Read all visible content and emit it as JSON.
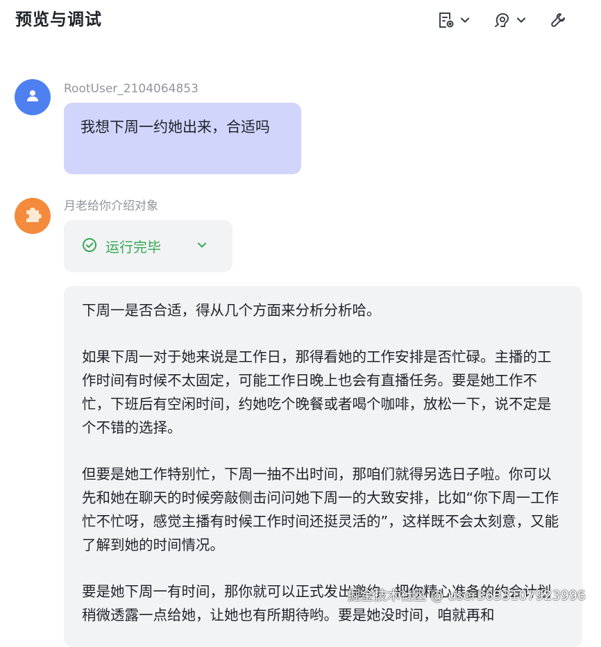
{
  "header": {
    "title": "预览与调试",
    "toolbar": [
      {
        "icon": "document-settings-icon",
        "has_dropdown": true
      },
      {
        "icon": "voice-settings-icon",
        "has_dropdown": true
      },
      {
        "icon": "wrench-icon",
        "has_dropdown": false
      }
    ]
  },
  "messages": {
    "user": {
      "name": "RootUser_2104064853",
      "avatar_icon": "user-icon",
      "text": "我想下周一约她出来，合适吗"
    },
    "bot": {
      "name": "月老给你介绍对象",
      "avatar_icon": "puzzle-icon",
      "status": {
        "label": "运行完毕",
        "icon": "check-circle-icon",
        "color": "#33a852"
      },
      "paragraphs": [
        "下周一是否合适，得从几个方面来分析分析哈。",
        "如果下周一对于她来说是工作日，那得看她的工作安排是否忙碌。主播的工作时间有时候不太固定，可能工作日晚上也会有直播任务。要是她工作不忙，下班后有空闲时间，约她吃个晚餐或者喝个咖啡，放松一下，说不定是个不错的选择。",
        "但要是她工作特别忙，下周一抽不出时间，那咱们就得另选日子啦。你可以先和她在聊天的时候旁敲侧击问问她下周一的大致安排，比如“你下周一工作忙不忙呀，感觉主播有时候工作时间还挺灵活的”，这样既不会太刻意，又能了解到她的时间情况。",
        "要是她下周一有时间，那你就可以正式发出邀约，把你精心准备的约会计划稍微透露一点给她，让她也有所期待哟。要是她没时间，咱就再和"
      ]
    }
  },
  "watermark": "掘金技术社区 @ user3633107923996",
  "colors": {
    "user_bubble": "#d1d5fc",
    "bot_card": "#f2f3f5",
    "user_avatar": "#4e80f0",
    "bot_avatar": "#f48a3c",
    "success": "#33a852"
  }
}
